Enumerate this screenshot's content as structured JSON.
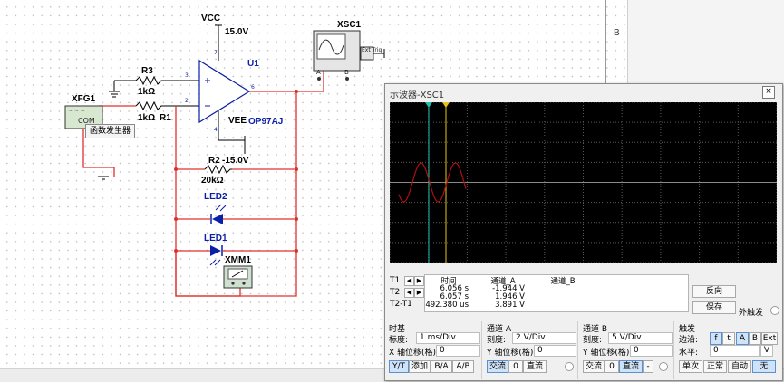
{
  "canvas": {
    "right_panel_label": "B"
  },
  "schematic": {
    "vcc_label": "VCC",
    "vcc_value": "15.0V",
    "vee_label": "VEE",
    "vee_value": "-15.0V",
    "opamp_ref": "U1",
    "opamp_model": "OP97AJ",
    "pin_labels": [
      "3",
      "2",
      "6",
      "7",
      "4"
    ],
    "r3_ref": "R3",
    "r3_value": "1kΩ",
    "r1_value": "1kΩ",
    "r1_ref": "R1",
    "r2_ref": "R2",
    "r2_value": "20kΩ",
    "led2_ref": "LED2",
    "led1_ref": "LED1",
    "xmm_ref": "XMM1",
    "xfg_ref": "XFG1",
    "xfg_com": "COM",
    "xfg_tooltip": "函数发生器",
    "xsc_ref": "XSC1",
    "xsc_ext": "Ext Trig",
    "xsc_a": "A",
    "xsc_b": "B"
  },
  "scope": {
    "title": "示波器-XSC1",
    "close_glyph": "×",
    "trace_color": "#b01010",
    "cursor1_color": "#1fbfae",
    "cursor2_color": "#e7c417",
    "measurements": {
      "headers": [
        "时间",
        "通道_A",
        "通道_B"
      ],
      "rows": [
        {
          "label": "T1",
          "time": "6.056 s",
          "a": "-1.944 V",
          "b": ""
        },
        {
          "label": "T2",
          "time": "6.057 s",
          "a": "1.946 V",
          "b": ""
        },
        {
          "label": "T2-T1",
          "time": "492.380 us",
          "a": "3.891 V",
          "b": ""
        }
      ]
    },
    "reverse_button": "反向",
    "save_button": "保存",
    "external_trigger_label": "外触发",
    "timebase": {
      "title": "时基",
      "scale_label": "标度:",
      "scale_value": "1 ms/Div",
      "xpos_label": "X 轴位移(格):",
      "xpos_value": "0",
      "buttons": [
        "Y/T",
        "添加",
        "B/A",
        "A/B"
      ]
    },
    "channel_a": {
      "title": "通道 A",
      "scale_label": "刻度:",
      "scale_value": "2  V/Div",
      "ypos_label": "Y 轴位移(格):",
      "ypos_value": "0",
      "buttons": [
        "交流",
        "0",
        "直流"
      ]
    },
    "channel_b": {
      "title": "通道 B",
      "scale_label": "刻度:",
      "scale_value": "5  V/Div",
      "ypos_label": "Y 轴位移(格):",
      "ypos_value": "0",
      "buttons": [
        "交流",
        "0",
        "直流",
        "-"
      ]
    },
    "trigger": {
      "title": "触发",
      "edge_label": "边沿:",
      "edge_buttons": [
        "f",
        "t",
        "A",
        "B",
        "Ext"
      ],
      "level_label": "水平:",
      "level_value": "0",
      "level_unit": "V",
      "mode_buttons": [
        "单次",
        "正常",
        "自动",
        "无"
      ]
    }
  }
}
